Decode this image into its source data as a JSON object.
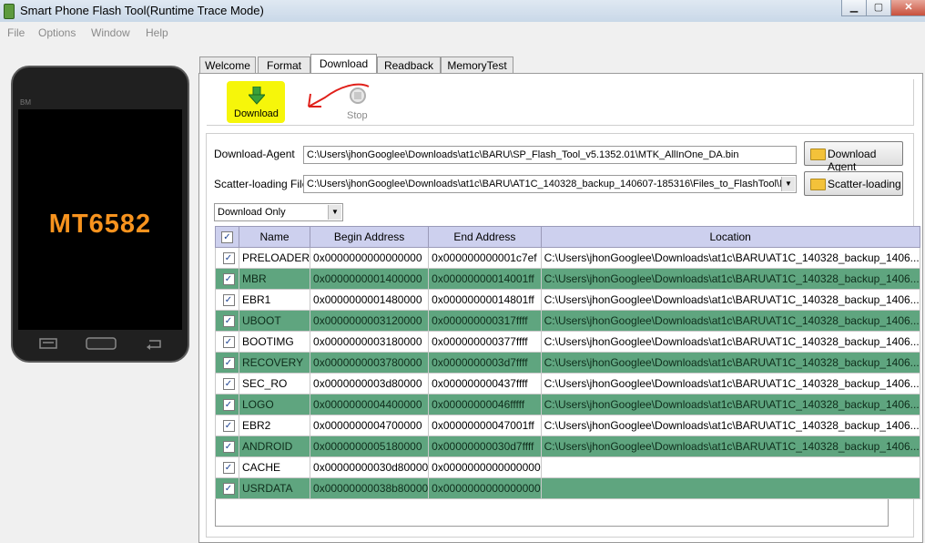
{
  "window": {
    "title": "Smart Phone Flash Tool(Runtime Trace Mode)"
  },
  "menu": [
    "File",
    "Options",
    "Window",
    "Help"
  ],
  "phone": {
    "brand": "BM",
    "chip": "MT6582"
  },
  "tabs": [
    "Welcome",
    "Format",
    "Download",
    "Readback",
    "MemoryTest"
  ],
  "active_tab": "Download",
  "toolbar": {
    "download_label": "Download",
    "stop_label": "Stop"
  },
  "form": {
    "download_agent_label": "Download-Agent",
    "download_agent_value": "C:\\Users\\jhonGooglee\\Downloads\\at1c\\BARU\\SP_Flash_Tool_v5.1352.01\\MTK_AllInOne_DA.bin",
    "download_agent_button": "Download Agent",
    "scatter_label": "Scatter-loading File",
    "scatter_value": "C:\\Users\\jhonGooglee\\Downloads\\at1c\\BARU\\AT1C_140328_backup_140607-185316\\Files_to_FlashTool\\MT",
    "scatter_button": "Scatter-loading",
    "mode_value": "Download Only"
  },
  "table": {
    "headers": [
      "Name",
      "Begin Address",
      "End Address",
      "Location"
    ],
    "rows": [
      {
        "name": "PRELOADER",
        "begin": "0x0000000000000000",
        "end": "0x000000000001c7ef",
        "location": "C:\\Users\\jhonGooglee\\Downloads\\at1c\\BARU\\AT1C_140328_backup_1406...",
        "highlight": false
      },
      {
        "name": "MBR",
        "begin": "0x0000000001400000",
        "end": "0x00000000014001ff",
        "location": "C:\\Users\\jhonGooglee\\Downloads\\at1c\\BARU\\AT1C_140328_backup_1406...",
        "highlight": true
      },
      {
        "name": "EBR1",
        "begin": "0x0000000001480000",
        "end": "0x00000000014801ff",
        "location": "C:\\Users\\jhonGooglee\\Downloads\\at1c\\BARU\\AT1C_140328_backup_1406...",
        "highlight": false
      },
      {
        "name": "UBOOT",
        "begin": "0x0000000003120000",
        "end": "0x000000000317ffff",
        "location": "C:\\Users\\jhonGooglee\\Downloads\\at1c\\BARU\\AT1C_140328_backup_1406...",
        "highlight": true
      },
      {
        "name": "BOOTIMG",
        "begin": "0x0000000003180000",
        "end": "0x000000000377ffff",
        "location": "C:\\Users\\jhonGooglee\\Downloads\\at1c\\BARU\\AT1C_140328_backup_1406...",
        "highlight": false
      },
      {
        "name": "RECOVERY",
        "begin": "0x0000000003780000",
        "end": "0x0000000003d7ffff",
        "location": "C:\\Users\\jhonGooglee\\Downloads\\at1c\\BARU\\AT1C_140328_backup_1406...",
        "highlight": true
      },
      {
        "name": "SEC_RO",
        "begin": "0x0000000003d80000",
        "end": "0x000000000437ffff",
        "location": "C:\\Users\\jhonGooglee\\Downloads\\at1c\\BARU\\AT1C_140328_backup_1406...",
        "highlight": false
      },
      {
        "name": "LOGO",
        "begin": "0x0000000004400000",
        "end": "0x00000000046fffff",
        "location": "C:\\Users\\jhonGooglee\\Downloads\\at1c\\BARU\\AT1C_140328_backup_1406...",
        "highlight": true
      },
      {
        "name": "EBR2",
        "begin": "0x0000000004700000",
        "end": "0x00000000047001ff",
        "location": "C:\\Users\\jhonGooglee\\Downloads\\at1c\\BARU\\AT1C_140328_backup_1406...",
        "highlight": false
      },
      {
        "name": "ANDROID",
        "begin": "0x0000000005180000",
        "end": "0x00000000030d7ffff",
        "location": "C:\\Users\\jhonGooglee\\Downloads\\at1c\\BARU\\AT1C_140328_backup_1406...",
        "highlight": true
      },
      {
        "name": "CACHE",
        "begin": "0x00000000030d80000",
        "end": "0x0000000000000000",
        "location": "",
        "highlight": false
      },
      {
        "name": "USRDATA",
        "begin": "0x00000000038b80000",
        "end": "0x0000000000000000",
        "location": "",
        "highlight": true
      }
    ]
  },
  "colors": {
    "highlight_row": "#5fa57f",
    "tool_highlight": "#f6f60a",
    "annotation_arrow": "#e0201a",
    "chip_text": "#f7931e"
  },
  "icons": [
    "app-icon",
    "download-arrow-icon",
    "stop-icon",
    "folder-icon",
    "checkbox-icon",
    "minimize-icon",
    "maximize-icon",
    "close-icon"
  ]
}
